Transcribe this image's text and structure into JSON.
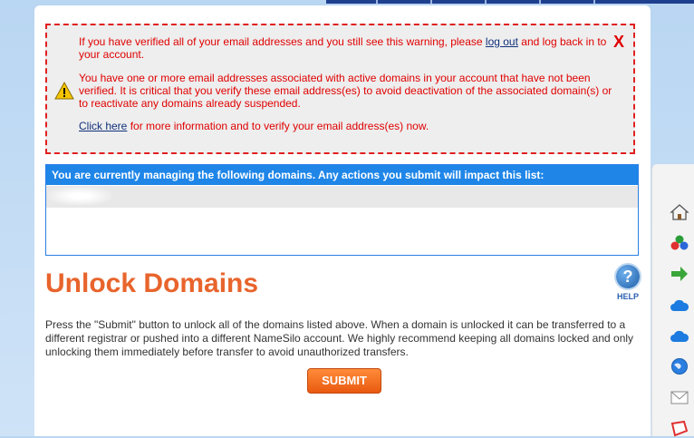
{
  "warning": {
    "close_label": "X",
    "para1_prefix": "If you have verified all of your email addresses and you still see this warning, please ",
    "para1_link": "log out",
    "para1_suffix": " and log back in to your account.",
    "para2": "You have one or more email addresses associated with active domains in your account that have not been verified. It is critical that you verify these email address(es) to avoid deactivation of the associated domain(s) or to reactivate any domains already suspended.",
    "para3_link": "Click here",
    "para3_suffix": " for more information and to verify your email address(es) now."
  },
  "managing": {
    "header": "You are currently managing the following domains. Any actions you submit will impact this list:"
  },
  "page": {
    "title": "Unlock Domains",
    "help_label": "HELP",
    "description": "Press the \"Submit\" button to unlock all of the domains listed above. When a domain is unlocked it can be transferred to a different registrar or pushed into a different NameSilo account. We highly recommend keeping all domains locked and only unlocking them immediately before transfer to avoid unauthorized transfers.",
    "submit_label": "SUBMIT"
  },
  "sidebar": {
    "icons": [
      "home-icon",
      "colored-circles-icon",
      "green-arrow-icon",
      "cloud-icon",
      "cloud-icon",
      "globe-icon",
      "envelope-icon",
      "red-tag-icon"
    ]
  },
  "colors": {
    "accent_orange": "#e8642c",
    "warning_red": "#e00000",
    "header_blue": "#1f86e8"
  }
}
